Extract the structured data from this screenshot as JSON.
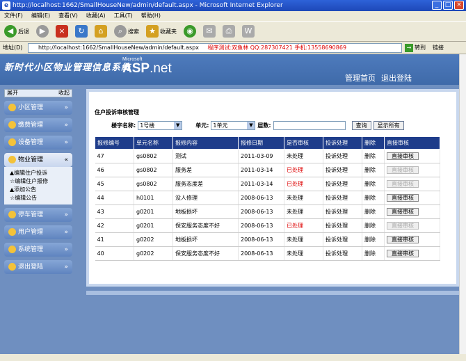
{
  "window": {
    "title": "http://localhost:1662/SmallHouseNew/admin/default.aspx - Microsoft Internet Explorer"
  },
  "menu": [
    "文件(F)",
    "编辑(E)",
    "查看(V)",
    "收藏(A)",
    "工具(T)",
    "帮助(H)"
  ],
  "toolbar": {
    "back": "后退",
    "search": "搜索",
    "favorites": "收藏夹"
  },
  "address": {
    "label": "地址(D)",
    "url": "http://localhost:1662/SmallHouseNew/admin/default.aspx",
    "marquee": "程序测试:双鱼林 QQ:287307421 手机:13558690869",
    "go": "转到",
    "links": "链接"
  },
  "banner": {
    "brand": "新时代小区物业管理信息系统",
    "asp_ms": "Microsoft",
    "asp_main": "ASP",
    "asp_net": ".net",
    "nav_home": "管理首页",
    "nav_logout": "退出登陆"
  },
  "sidebar": {
    "expand": "展开",
    "collapse": "收起",
    "groups": [
      "小区管理",
      "缴费管理",
      "设备管理",
      "物业管理",
      "停车管理",
      "用户管理",
      "系统管理",
      "退出登陆"
    ],
    "subitems": [
      "编辑住户投诉",
      "编辑住户报修",
      "添加公告",
      "编辑公告"
    ]
  },
  "main": {
    "title": "住户投诉审核管理",
    "building_label": "楼字名称:",
    "building_value": "1号楼",
    "unit_label": "单元:",
    "unit_value": "1单元",
    "floor_label": "层数:",
    "query_btn": "查询",
    "showall_btn": "显示所有"
  },
  "table": {
    "headers": [
      "报修编号",
      "单元名称",
      "报修内容",
      "报修日期",
      "是否审核",
      "投诉处理",
      "删除",
      "直接审核"
    ],
    "rows": [
      {
        "id": "47",
        "unit": "gs0802",
        "content": "测试",
        "date": "2011-03-09",
        "status": "未处理",
        "handle": "投诉处理",
        "del": "删除",
        "action": "直接审核",
        "done": false
      },
      {
        "id": "46",
        "unit": "gs0802",
        "content": "服务差",
        "date": "2011-03-14",
        "status": "已处理",
        "handle": "投诉处理",
        "del": "删除",
        "action": "直接审核",
        "done": true
      },
      {
        "id": "45",
        "unit": "gs0802",
        "content": "服务态度差",
        "date": "2011-03-14",
        "status": "已处理",
        "handle": "投诉处理",
        "del": "删除",
        "action": "直接审核",
        "done": true
      },
      {
        "id": "44",
        "unit": "h0101",
        "content": "没人修理",
        "date": "2008-06-13",
        "status": "未处理",
        "handle": "投诉处理",
        "del": "删除",
        "action": "直接审核",
        "done": false
      },
      {
        "id": "43",
        "unit": "g0201",
        "content": "地板损坏",
        "date": "2008-06-13",
        "status": "未处理",
        "handle": "投诉处理",
        "del": "删除",
        "action": "直接审核",
        "done": false
      },
      {
        "id": "42",
        "unit": "g0201",
        "content": "保安服务态度不好",
        "date": "2008-06-13",
        "status": "已处理",
        "handle": "投诉处理",
        "del": "删除",
        "action": "直接审核",
        "done": true
      },
      {
        "id": "41",
        "unit": "g0202",
        "content": "地板损坏",
        "date": "2008-06-13",
        "status": "未处理",
        "handle": "投诉处理",
        "del": "删除",
        "action": "直接审核",
        "done": false
      },
      {
        "id": "40",
        "unit": "g0202",
        "content": "保安服务态度不好",
        "date": "2008-06-13",
        "status": "未处理",
        "handle": "投诉处理",
        "del": "删除",
        "action": "直接审核",
        "done": false
      }
    ]
  },
  "colors": {
    "titlebar": "#1d48b8",
    "banner": "#4e7bbd",
    "table_header": "#1e3c8a",
    "processed": "#dd0000"
  }
}
